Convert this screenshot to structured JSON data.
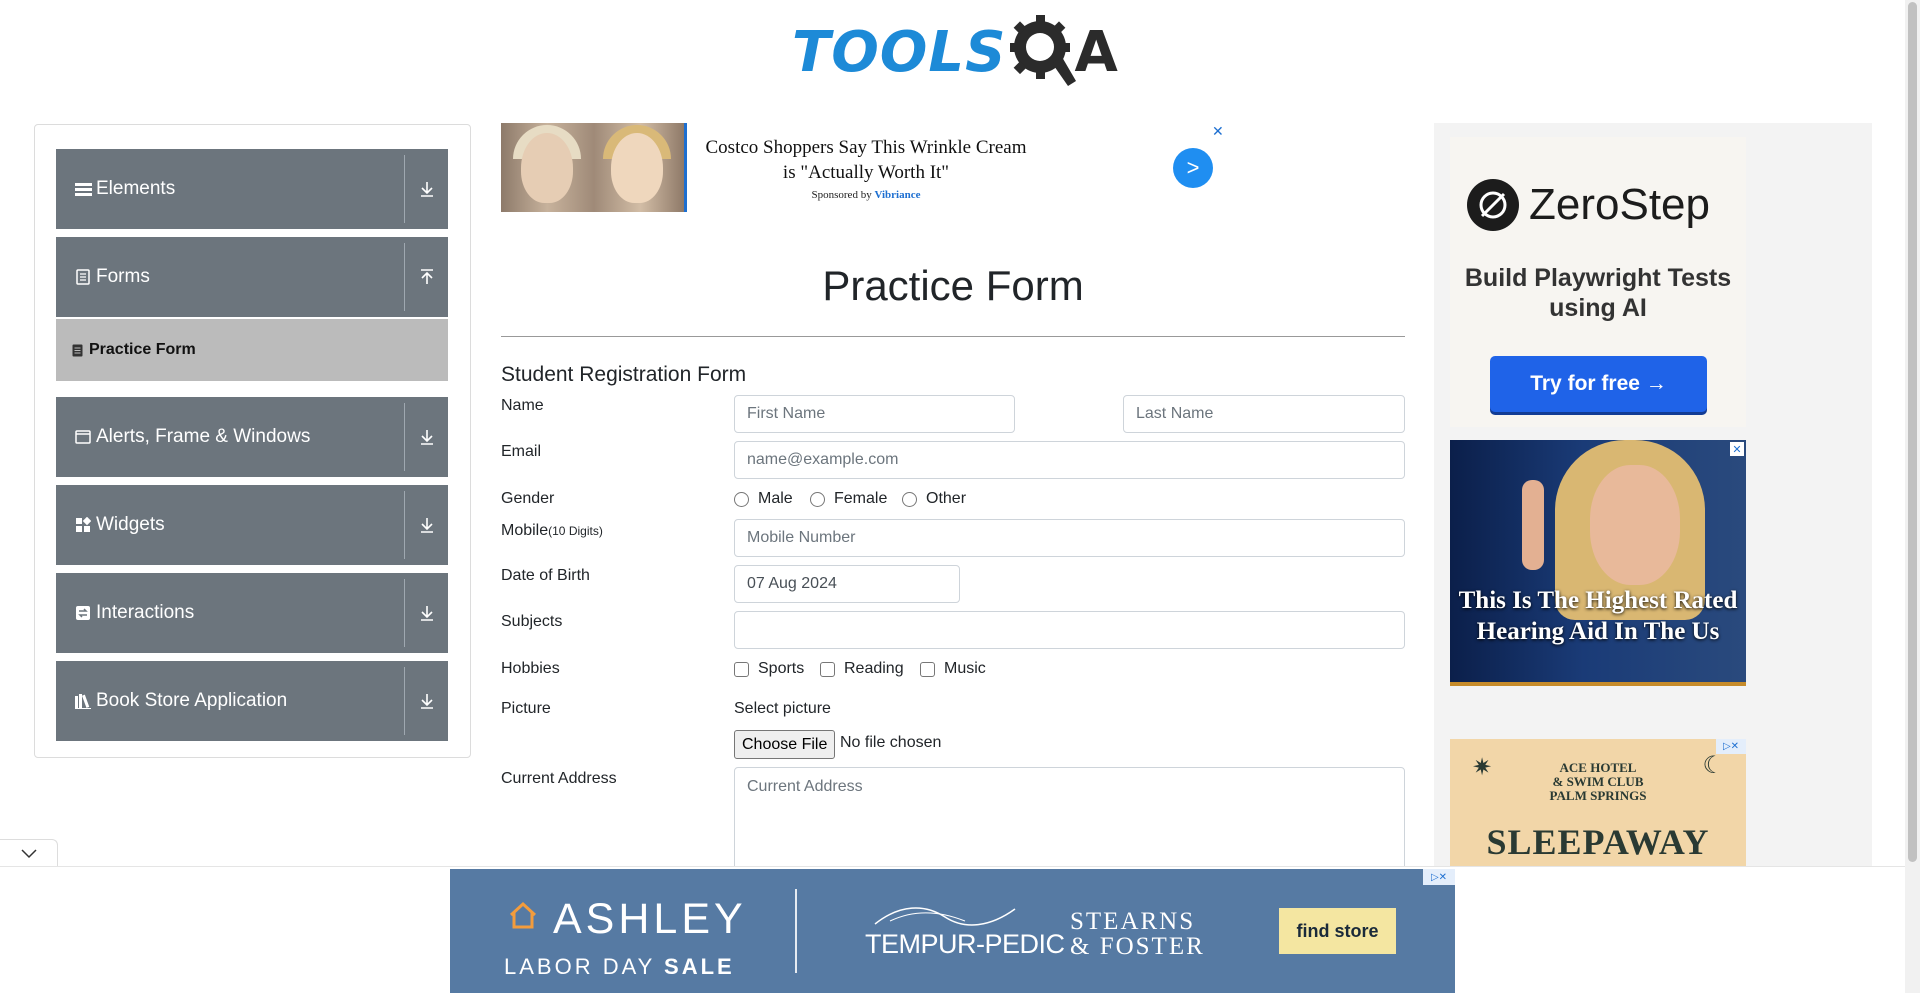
{
  "logo": {
    "text": "TOOLS",
    "letter": "A"
  },
  "nav": {
    "groups": [
      {
        "label": "Elements",
        "icon": "bars-icon"
      },
      {
        "label": "Forms",
        "icon": "document-icon"
      },
      {
        "label": "Alerts, Frame & Windows",
        "icon": "window-icon"
      },
      {
        "label": "Widgets",
        "icon": "widgets-icon"
      },
      {
        "label": "Interactions",
        "icon": "interactions-icon"
      },
      {
        "label": "Book Store Application",
        "icon": "books-icon"
      }
    ],
    "active_item": "Practice Form"
  },
  "top_ad": {
    "headline": "Costco Shoppers Say This Wrinkle Cream is \"Actually Worth It\"",
    "sponsor_prefix": "Sponsored by",
    "sponsor_name": "Vibriance",
    "go": ">",
    "close": "✕"
  },
  "form": {
    "title": "Practice Form",
    "subtitle": "Student Registration Form",
    "labels": {
      "name": "Name",
      "email": "Email",
      "gender": "Gender",
      "mobile": "Mobile",
      "mobile_hint": "(10 Digits)",
      "dob": "Date of Birth",
      "subjects": "Subjects",
      "hobbies": "Hobbies",
      "picture": "Picture",
      "address": "Current Address"
    },
    "placeholders": {
      "first_name": "First Name",
      "last_name": "Last Name",
      "email": "name@example.com",
      "mobile": "Mobile Number",
      "address": "Current Address"
    },
    "dob_value": "07 Aug 2024",
    "genders": [
      "Male",
      "Female",
      "Other"
    ],
    "hobbies": [
      "Sports",
      "Reading",
      "Music"
    ],
    "picture_label": "Select picture",
    "file_button": "Choose File",
    "file_status": "No file chosen"
  },
  "right_ads": {
    "zerostep": {
      "name": "ZeroStep",
      "tagline": "Build Playwright Tests using AI",
      "button": "Try for free →"
    },
    "hearing": {
      "text": "This Is The Highest Rated Hearing Aid In The Us",
      "close": "✕"
    },
    "ace": {
      "line1": "ACE HOTEL",
      "line2": "& SWIM CLUB",
      "line3": "PALM SPRINGS",
      "title": "SLEEPAWAY"
    }
  },
  "bottom_ad": {
    "brand": "ASHLEY",
    "sale_prefix": "LABOR DAY",
    "sale_word": "SALE",
    "partner1": "TEMPUR-PEDIC",
    "partner2_line1": "STEARNS",
    "partner2_line2": "& FOSTER",
    "button": "find store"
  },
  "colors": {
    "nav_bg": "#6c757d",
    "active_bg": "#bbbbbb",
    "logo_blue": "#1d8ad7",
    "zerostep_button": "#1f63e8",
    "ashley_bg": "#567aa3"
  }
}
